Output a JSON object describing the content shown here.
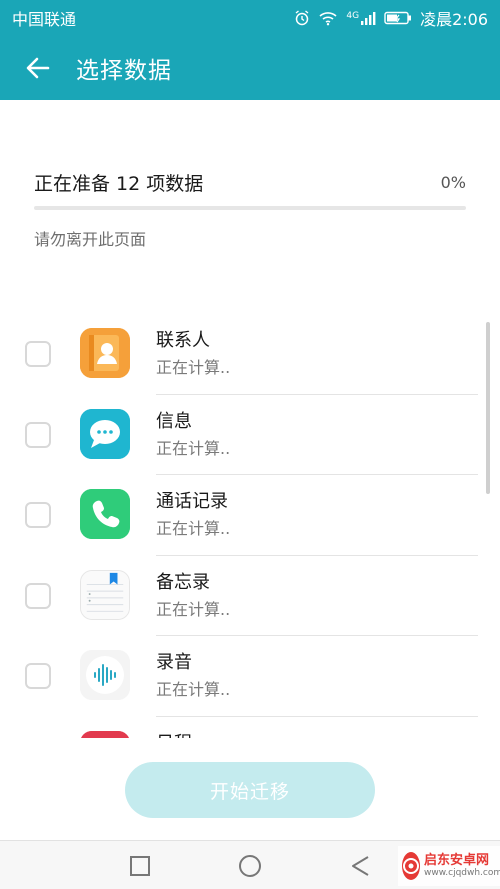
{
  "status_bar": {
    "carrier": "中国联通",
    "time": "凌晨2:06",
    "signal_label": "4G"
  },
  "app_bar": {
    "title": "选择数据"
  },
  "progress": {
    "text": "正在准备 12 项数据",
    "percent_label": "0%",
    "value": 0,
    "hint": "请勿离开此页面"
  },
  "items": [
    {
      "title": "联系人",
      "status": "正在计算.."
    },
    {
      "title": "信息",
      "status": "正在计算.."
    },
    {
      "title": "通话记录",
      "status": "正在计算.."
    },
    {
      "title": "备忘录",
      "status": "正在计算.."
    },
    {
      "title": "录音",
      "status": "正在计算.."
    },
    {
      "title": "日程",
      "status": ""
    }
  ],
  "start_button": {
    "label": "开始迁移"
  },
  "watermark": {
    "name": "启东安卓网",
    "url": "www.cjqdwh.com"
  },
  "colors": {
    "accent": "#1aa6b7",
    "button_disabled": "#c4ebee"
  }
}
